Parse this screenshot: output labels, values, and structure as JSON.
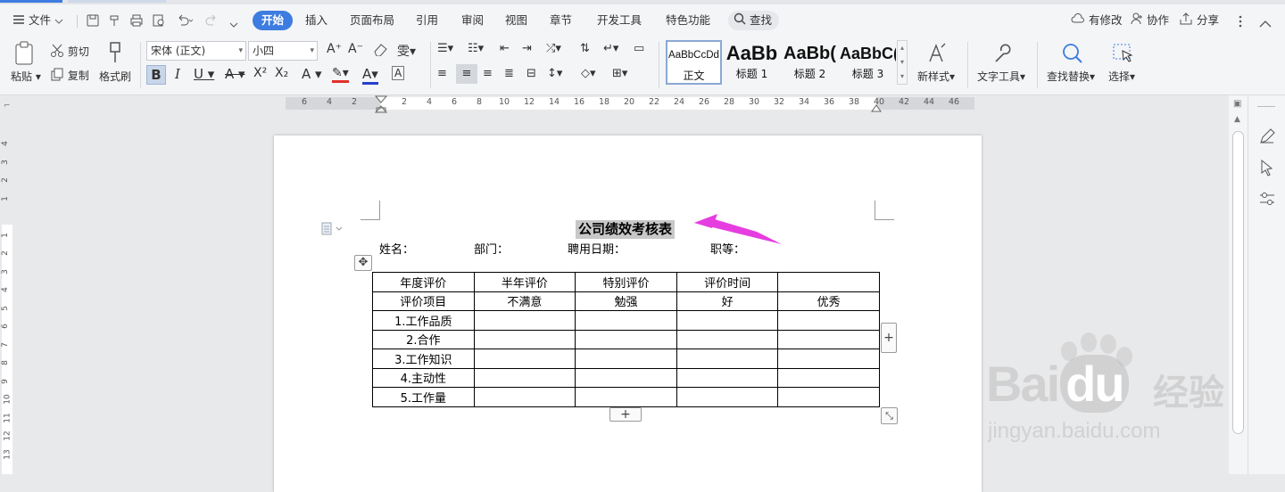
{
  "app": {
    "accent": "#3d7ce0"
  },
  "menubar": {
    "file": "文件",
    "tabs": [
      "开始",
      "插入",
      "页面布局",
      "引用",
      "审阅",
      "视图",
      "章节",
      "开发工具",
      "特色功能"
    ],
    "search": "查找",
    "right": {
      "modified": "有修改",
      "collab": "协作",
      "share": "分享"
    }
  },
  "ribbon": {
    "paste": "粘贴",
    "cut": "剪切",
    "copy": "复制",
    "format_painter": "格式刷",
    "font_name": "宋体 (正文)",
    "font_size": "小四",
    "styles": [
      {
        "preview": "AaBbCcDd",
        "name": "正文"
      },
      {
        "preview": "AaBb",
        "name": "标题 1"
      },
      {
        "preview": "AaBb(",
        "name": "标题 2"
      },
      {
        "preview": "AaBbC(",
        "name": "标题 3"
      }
    ],
    "new_style": "新样式",
    "text_tools": "文字工具",
    "find_replace": "查找替换",
    "select": "选择"
  },
  "ruler": {
    "ticks": [
      "6",
      "4",
      "2",
      "",
      "2",
      "4",
      "6",
      "8",
      "10",
      "12",
      "14",
      "16",
      "18",
      "20",
      "22",
      "24",
      "26",
      "28",
      "30",
      "32",
      "34",
      "36",
      "38",
      "40",
      "42",
      "44",
      "46"
    ]
  },
  "vruler": {
    "ticks": [
      "4",
      "3",
      "2",
      "1",
      "",
      "1",
      "2",
      "3",
      "4",
      "5",
      "6",
      "7",
      "8",
      "9",
      "10",
      "11",
      "12",
      "13"
    ]
  },
  "document": {
    "title": "公司绩效考核表",
    "fields": [
      "姓名：",
      "部门：",
      "聘用日期：",
      "职等："
    ],
    "table": [
      [
        "年度评价",
        "半年评价",
        "特别评价",
        "评价时间",
        ""
      ],
      [
        "评价项目",
        "不满意",
        "勉强",
        "好",
        "优秀"
      ],
      [
        "1.工作品质",
        "",
        "",
        "",
        ""
      ],
      [
        "2.合作",
        "",
        "",
        "",
        ""
      ],
      [
        "3.工作知识",
        "",
        "",
        "",
        ""
      ],
      [
        "4.主动性",
        "",
        "",
        "",
        ""
      ],
      [
        "5.工作量",
        "",
        "",
        "",
        ""
      ]
    ]
  },
  "watermark": {
    "brand": "Bai",
    "brand2": "du",
    "cn": "经验",
    "url": "jingyan.baidu.com"
  }
}
